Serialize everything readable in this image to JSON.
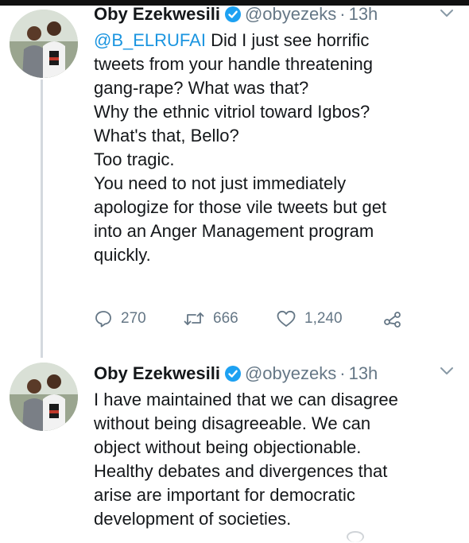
{
  "tweets": [
    {
      "author": {
        "name": "Oby Ezekwesili",
        "handle": "@obyezeks",
        "time": "13h"
      },
      "mention": "@B_ELRUFAI",
      "lines": [
        "Did I just see horrific",
        "tweets from your handle threatening",
        "gang-rape? What was that?",
        "Why the ethnic vitriol toward Igbos?",
        "What's that, Bello?",
        "Too tragic.",
        "You need to not just immediately",
        "apologize for those vile tweets but get",
        "into an Anger Management program",
        "quickly."
      ],
      "actions": {
        "replies": "270",
        "retweets": "666",
        "likes": "1,240"
      }
    },
    {
      "author": {
        "name": "Oby Ezekwesili",
        "handle": "@obyezeks",
        "time": "13h"
      },
      "lines": [
        "I have maintained that we can disagree",
        "without being disagreeable. We can",
        "object without being objectionable.",
        "Healthy debates and divergences that",
        "arise are important for democratic",
        "development of societies."
      ]
    }
  ],
  "icons": {
    "verified": "verified-badge-icon",
    "more": "chevron-down-icon",
    "reply": "reply-icon",
    "retweet": "retweet-icon",
    "like": "heart-icon",
    "share": "share-icon"
  },
  "colors": {
    "text": "#14171a",
    "muted": "#657786",
    "link": "#1b95e0",
    "verified": "#1da1f2"
  }
}
